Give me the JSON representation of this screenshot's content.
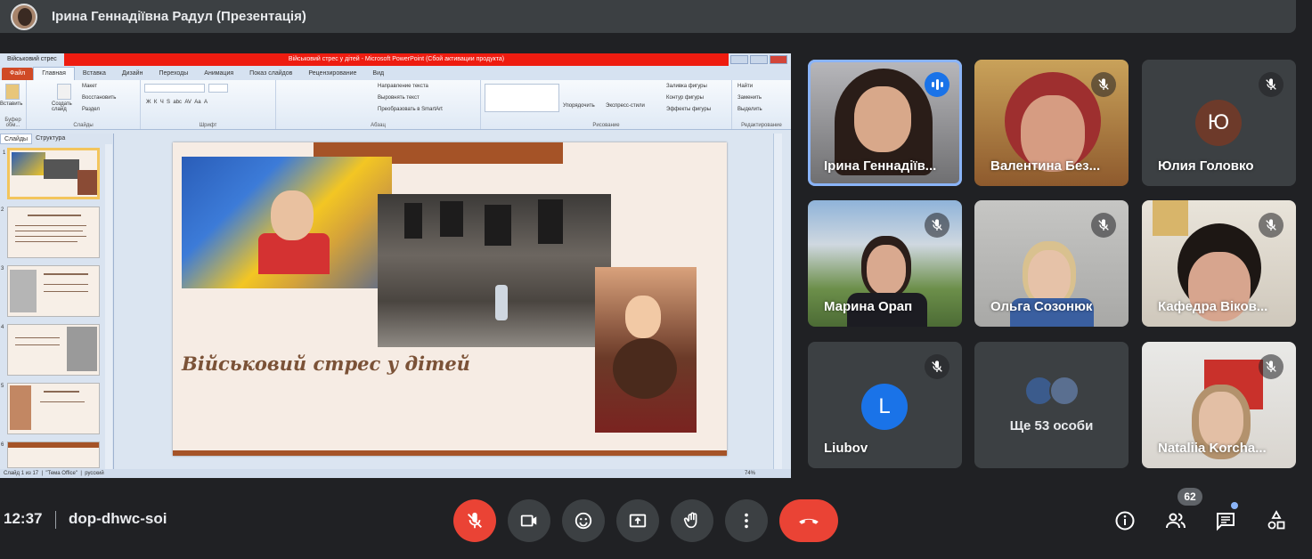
{
  "presenter_bar": {
    "title": "Ірина Геннадіївна Радул (Презентація)"
  },
  "ppt": {
    "window_title": "Військовий стрес у дітей  -  Microsoft PowerPoint (Сбой активации продукта)",
    "file_name": "Військовий стрес",
    "tabs": [
      "Файл",
      "Главная",
      "Вставка",
      "Дизайн",
      "Переходы",
      "Анимация",
      "Показ слайдов",
      "Рецензирование",
      "Вид"
    ],
    "ribbon": {
      "paste": "Вставить",
      "clipboard": "Буфер обм...",
      "create_slide": "Создать слайд",
      "layout": "Макет",
      "reset": "Восстановить",
      "section": "Раздел",
      "slides_group": "Слайды",
      "font_group": "Шрифт",
      "paragraph_group": "Абзац",
      "text_direction": "Направление текста",
      "align_text": "Выровнять текст",
      "convert_smartart": "Преобразовать в SmartArt",
      "arrange": "Упорядочить",
      "quick_styles": "Экспресс-стили",
      "shape_fill": "Заливка фигуры",
      "shape_outline": "Контур фигуры",
      "shape_effects": "Эффекты фигуры",
      "drawing_group": "Рисование",
      "find": "Найти",
      "replace": "Заменить",
      "select": "Выделить",
      "editing_group": "Редактирование"
    },
    "panel_tabs": [
      "Слайды",
      "Структура"
    ],
    "thumbnails": [
      "1",
      "2",
      "3",
      "4",
      "5",
      "6"
    ],
    "slide_title": "Військовий стрес у дітей",
    "status": {
      "slide": "Слайд 1 из 17",
      "theme": "\"Тема Office\"",
      "lang": "русский",
      "zoom": "74%"
    }
  },
  "participants": [
    {
      "name": "Ірина Геннадіїв...",
      "speaking": true
    },
    {
      "name": "Валентина Без...",
      "muted": true
    },
    {
      "name": "Юлия Головко",
      "muted": true,
      "initial": "Ю",
      "avatar_color": "#6d3a2a"
    },
    {
      "name": "Марина Орап",
      "muted": true
    },
    {
      "name": "Ольга Созонюк",
      "muted": true
    },
    {
      "name": "Кафедра Віков...",
      "muted": true
    },
    {
      "name": "Liubov",
      "muted": true,
      "initial": "L",
      "avatar_color": "#1a73e8"
    },
    {
      "name": "Ще 53 особи"
    },
    {
      "name": "Nataliia Korcha...",
      "muted": true
    }
  ],
  "bottom": {
    "time": "12:37",
    "meeting_code": "dop-dhwc-soi",
    "people_count": "62"
  },
  "colors": {
    "end_call": "#ea4335",
    "bar_bg": "#3c4043",
    "accent": "#8ab4f8"
  }
}
